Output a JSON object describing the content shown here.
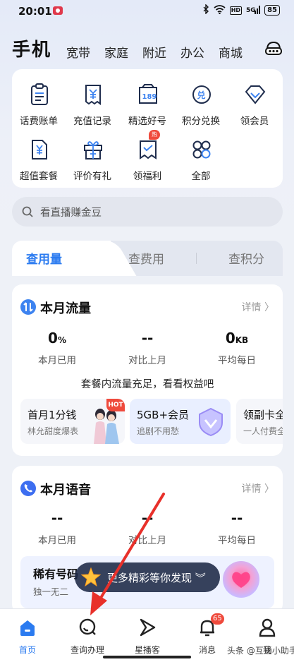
{
  "status_bar": {
    "time": "20:01",
    "hd": "HD",
    "signal": "5G",
    "battery": "85"
  },
  "nav": {
    "main": "手机",
    "tabs": [
      "宽带",
      "家庭",
      "附近",
      "办公",
      "商城"
    ]
  },
  "quick_grid": {
    "items": [
      {
        "label": "话费账单",
        "icon": "bill-icon"
      },
      {
        "label": "充值记录",
        "icon": "recharge-record-icon"
      },
      {
        "label": "精选好号",
        "icon": "number-189-icon"
      },
      {
        "label": "积分兑换",
        "icon": "points-exchange-icon"
      },
      {
        "label": "领会员",
        "icon": "member-diamond-icon"
      },
      {
        "label": "超值套餐",
        "icon": "package-icon"
      },
      {
        "label": "评价有礼",
        "icon": "gift-icon"
      },
      {
        "label": "领福利",
        "icon": "welfare-icon"
      },
      {
        "label": "全部",
        "icon": "all-apps-icon"
      }
    ],
    "hot_badge": "热"
  },
  "search": {
    "placeholder": "看直播赚金豆"
  },
  "segments": {
    "active": "查用量",
    "tab2": "查费用",
    "tab3": "查积分"
  },
  "flow_card": {
    "title": "本月流量",
    "more": "详情 〉",
    "stats": [
      {
        "value": "0",
        "unit": "%",
        "label": "本月已用"
      },
      {
        "value": "--",
        "unit": "",
        "label": "对比上月"
      },
      {
        "value": "0",
        "unit": "KB",
        "label": "平均每日"
      }
    ],
    "tip": "套餐内流量充足，看看权益吧",
    "promos": [
      {
        "title": "首月1分钱",
        "sub": "林允甜度爆表",
        "badge": "HOT"
      },
      {
        "title": "5GB+会员",
        "sub": "追剧不用愁"
      },
      {
        "title": "领副卡全",
        "sub": "一人付费全"
      }
    ]
  },
  "voice_card": {
    "title": "本月语音",
    "more": "详情 〉",
    "stats": [
      {
        "value": "--",
        "label": "本月已用"
      },
      {
        "value": "--",
        "label": "对比上月"
      },
      {
        "value": "--",
        "label": "平均每日"
      }
    ],
    "rare_title": "稀有号码",
    "rare_sub": "独一无二"
  },
  "discover": {
    "text": "更多精彩等你发现 ︾"
  },
  "bottom_nav": [
    {
      "label": "首页",
      "active": true
    },
    {
      "label": "查询办理"
    },
    {
      "label": "星播客"
    },
    {
      "label": "消息",
      "badge": "65"
    },
    {
      "label": "我"
    }
  ],
  "watermark": "头条 @互通小助手",
  "colors": {
    "accent": "#2b7bf0",
    "badge": "#ef4a3c",
    "annotation_arrow": "#e8302a"
  }
}
